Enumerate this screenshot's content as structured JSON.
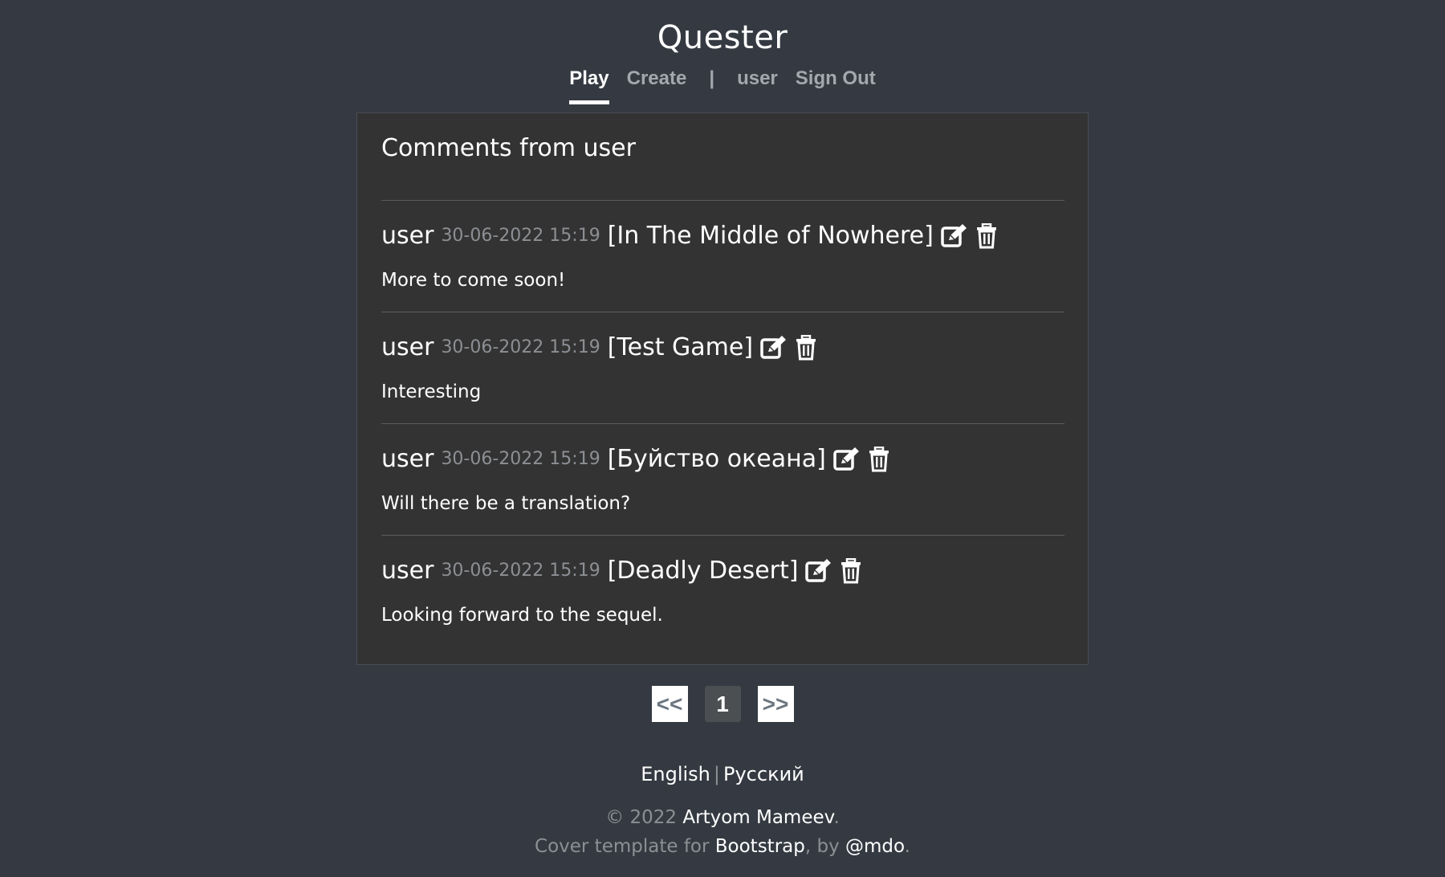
{
  "app": {
    "title": "Quester"
  },
  "nav": {
    "play": "Play",
    "create": "Create",
    "separator": "|",
    "user": "user",
    "sign_out": "Sign Out"
  },
  "page": {
    "title": "Comments from user"
  },
  "comments": [
    {
      "user": "user",
      "date": "30-06-2022 15:19",
      "game": "[In The Middle of Nowhere]",
      "text": "More to come soon!",
      "icons": [
        "edit-icon",
        "trash-icon"
      ]
    },
    {
      "user": "user",
      "date": "30-06-2022 15:19",
      "game": "[Test Game]",
      "text": "Interesting",
      "icons": [
        "edit-icon",
        "trash-icon"
      ]
    },
    {
      "user": "user",
      "date": "30-06-2022 15:19",
      "game": "[Буйство океана]",
      "text": "Will there be a translation?",
      "icons": [
        "edit-icon",
        "trash-icon"
      ]
    },
    {
      "user": "user",
      "date": "30-06-2022 15:19",
      "game": "[Deadly Desert]",
      "text": "Looking forward to the sequel.",
      "icons": [
        "edit-icon",
        "trash-icon"
      ]
    }
  ],
  "pagination": {
    "prev": "<<",
    "current": "1",
    "next": ">>"
  },
  "languages": {
    "english": "English",
    "separator": "|",
    "russian": "Русский"
  },
  "footer": {
    "copyright_prefix": "© 2022 ",
    "author": "Artyom Mameev",
    "period": ".",
    "template_prefix": "Cover template for ",
    "bootstrap": "Bootstrap",
    "by": ", by ",
    "mdo": "@mdo",
    "end": "."
  },
  "colors": {
    "background": "#353a42",
    "card": "#333333",
    "muted": "#8c8f93",
    "nav_inactive": "#a4a8ae"
  }
}
